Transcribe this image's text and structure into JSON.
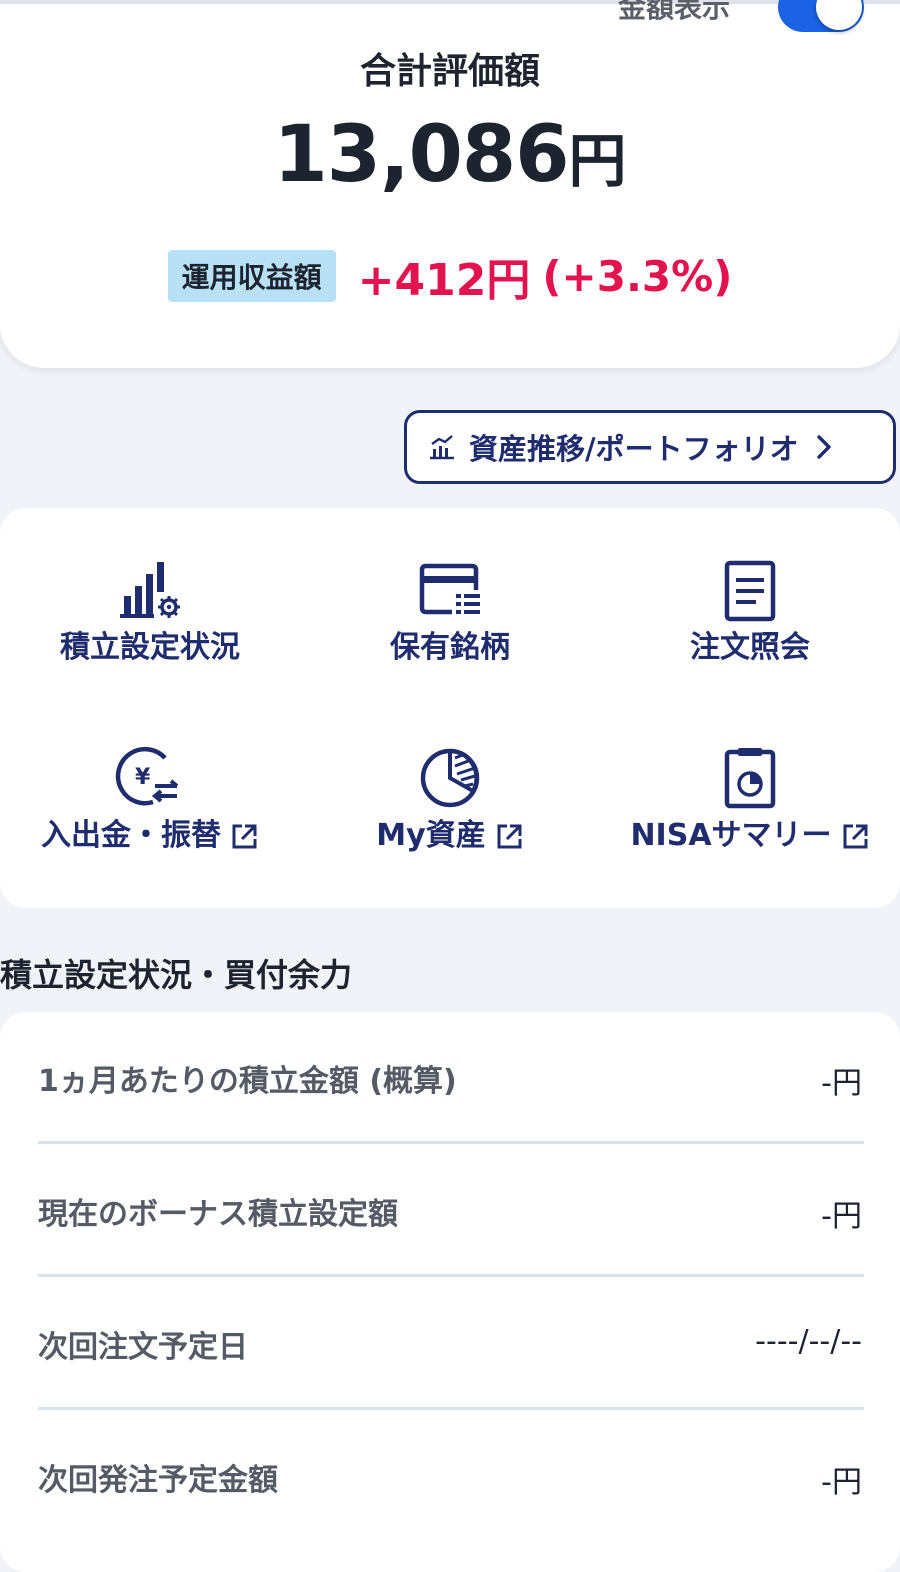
{
  "summary": {
    "toggle_label": "金額表示",
    "toggle_on": true,
    "title": "合計評価額",
    "total_value": "13,086",
    "total_unit": "円",
    "gain_label": "運用収益額",
    "gain_value": "+412円",
    "gain_percent": "(+3.3%)"
  },
  "portfolio_button": {
    "label": "資産推移/ポートフォリオ",
    "icon": "chart-icon"
  },
  "menu": {
    "items": [
      {
        "label": "積立設定状況",
        "icon": "bar-chart-gear-icon",
        "external": false
      },
      {
        "label": "保有銘柄",
        "icon": "card-list-icon",
        "external": false
      },
      {
        "label": "注文照会",
        "icon": "document-icon",
        "external": false
      },
      {
        "label": "入出金・振替",
        "icon": "yen-transfer-icon",
        "external": true
      },
      {
        "label": "My資産",
        "icon": "pie-chart-icon",
        "external": true
      },
      {
        "label": "NISAサマリー",
        "icon": "clipboard-pie-icon",
        "external": true
      }
    ]
  },
  "accumulation": {
    "title": "積立設定状況・買付余力",
    "rows": [
      {
        "label": "1ヵ月あたりの積立金額 (概算)",
        "value": "-円"
      },
      {
        "label": "現在のボーナス積立設定額",
        "value": "-円"
      },
      {
        "label": "次回注文予定日",
        "value": "----/--/--"
      },
      {
        "label": "次回発注予定金額",
        "value": "-円"
      }
    ]
  },
  "colors": {
    "accent": "#1b62e5",
    "navy": "#1f2d6e",
    "gain": "#e2134e",
    "badge": "#b8e1f7"
  }
}
